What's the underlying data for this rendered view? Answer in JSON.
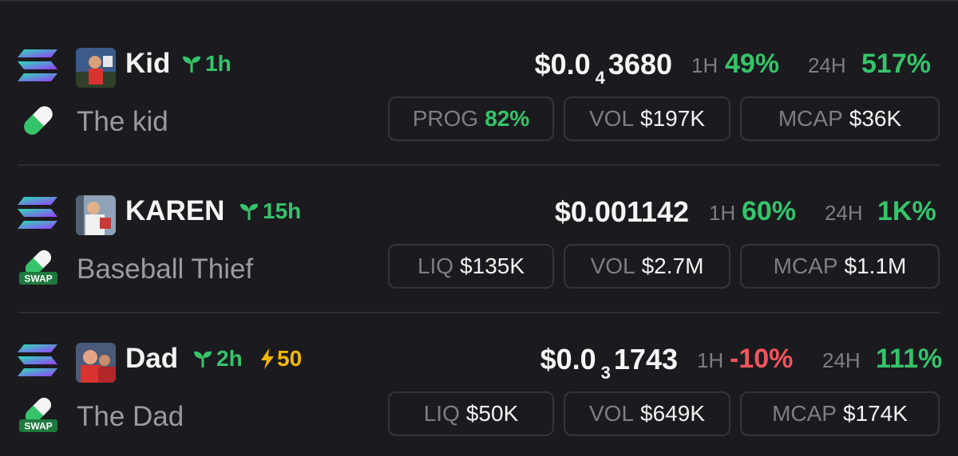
{
  "tokens": [
    {
      "name": "Kid",
      "age": "1h",
      "boost": null,
      "description": "The kid",
      "price_prefix": "$0.0",
      "price_subscript": "4",
      "price_rest": "3680",
      "price_full": "",
      "h1_label": "1H",
      "h1_value": "49%",
      "h24_label": "24H",
      "h24_value": "517%",
      "platform_icon": "pill-icon",
      "stats": [
        {
          "label": "PROG",
          "value": "82%"
        },
        {
          "label": "VOL",
          "value": "$197K"
        },
        {
          "label": "MCAP",
          "value": "$36K"
        }
      ]
    },
    {
      "name": "KAREN",
      "age": "15h",
      "boost": null,
      "description": "Baseball Thief",
      "price_prefix": "",
      "price_subscript": "",
      "price_rest": "",
      "price_full": "$0.001142",
      "h1_label": "1H",
      "h1_value": "60%",
      "h24_label": "24H",
      "h24_value": "1K%",
      "platform_icon": "swap-icon",
      "stats": [
        {
          "label": "LIQ",
          "value": "$135K"
        },
        {
          "label": "VOL",
          "value": "$2.7M"
        },
        {
          "label": "MCAP",
          "value": "$1.1M"
        }
      ]
    },
    {
      "name": "Dad",
      "age": "2h",
      "boost": "50",
      "description": "The Dad",
      "price_prefix": "$0.0",
      "price_subscript": "3",
      "price_rest": "1743",
      "price_full": "",
      "h1_label": "1H",
      "h1_value": "-10%",
      "h24_label": "24H",
      "h24_value": "111%",
      "platform_icon": "swap-icon",
      "stats": [
        {
          "label": "LIQ",
          "value": "$50K"
        },
        {
          "label": "VOL",
          "value": "$649K"
        },
        {
          "label": "MCAP",
          "value": "$174K"
        }
      ]
    }
  ],
  "swap_badge_text": "SWAP",
  "colors": {
    "background": "#1b1b1f",
    "positive": "#35c46a",
    "negative": "#f0555b",
    "boost": "#f2b705",
    "muted": "#7d7d82",
    "pill_border": "#34343a"
  }
}
